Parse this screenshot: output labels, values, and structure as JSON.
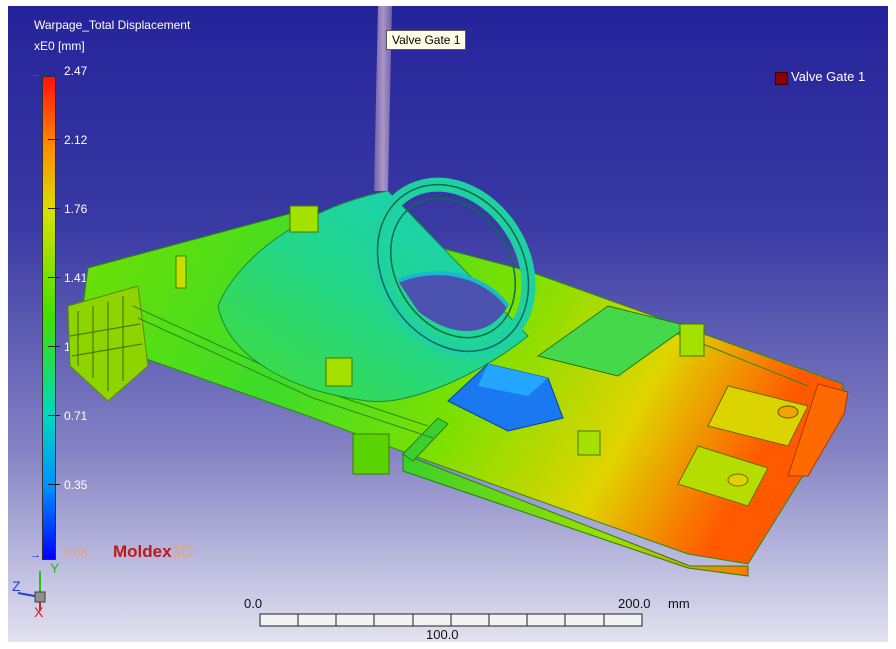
{
  "result": {
    "title": "Warpage_Total Displacement",
    "unit": "xE0 [mm]"
  },
  "colorbar": {
    "ticks": [
      "2.47",
      "2.12",
      "1.76",
      "1.41",
      "1.06",
      "0.71",
      "0.35",
      "0.00"
    ],
    "colors": [
      "#ff1010",
      "#ff8a00",
      "#d8e000",
      "#40e000",
      "#00d8c0",
      "#0090ff",
      "#0000ff"
    ]
  },
  "gate": {
    "tooltip": "Valve Gate 1",
    "legend_label": "Valve Gate 1",
    "legend_color": "#8a0000"
  },
  "brand": {
    "name": "Moldex",
    "suffix": "3D"
  },
  "triad": {
    "x": "X",
    "y": "Y",
    "z": "Z"
  },
  "scale": {
    "start": "0.0",
    "end": "200.0",
    "unit": "mm",
    "mid": "100.0"
  }
}
